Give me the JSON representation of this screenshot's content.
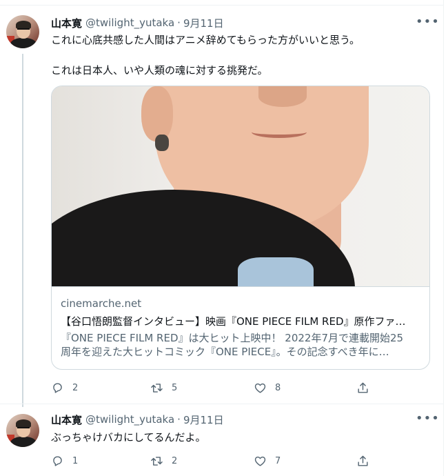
{
  "tweets": [
    {
      "name": "山本寛",
      "handle": "@twilight_yutaka",
      "separator": "·",
      "time": "9月11日",
      "more": "•••",
      "text_lines": [
        "これに心底共感した人間はアニメ辞めてもらった方がいいと思う。",
        "これは日本人、いや人類の魂に対する挑発だ。"
      ],
      "card": {
        "domain": "cinemarche.net",
        "title": "【谷口悟朗監督インタビュー】映画『ONE PIECE FILM RED』原作ファ…",
        "desc_lines": [
          "『ONE PIECE FILM RED』は大ヒット上映中！ 2022年7月で連載開始25",
          "周年を迎えた大ヒットコミック『ONE PIECE』。その記念すべき年に…"
        ]
      },
      "actions": {
        "reply": "2",
        "retweet": "5",
        "like": "8"
      }
    },
    {
      "name": "山本寛",
      "handle": "@twilight_yutaka",
      "separator": "·",
      "time": "9月11日",
      "more": "•••",
      "text_lines": [
        "ぶっちゃけバカにしてるんだよ。"
      ],
      "actions": {
        "reply": "1",
        "retweet": "2",
        "like": "7"
      }
    }
  ],
  "icons": {
    "reply": "reply-icon",
    "retweet": "retweet-icon",
    "like": "heart-icon",
    "share": "share-icon",
    "more": "more-icon"
  },
  "colors": {
    "text": "#0f1419",
    "secondary": "#536471",
    "border": "#cfd9de"
  }
}
